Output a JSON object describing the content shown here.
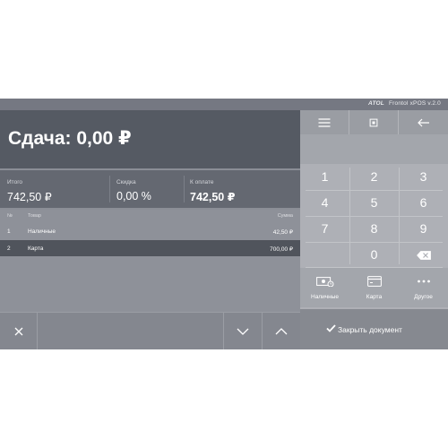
{
  "app": {
    "logo": "ATOL",
    "title": "Frontol xPOS v.2.0"
  },
  "change": {
    "text": "Сдача: 0,00 ₽"
  },
  "totals": {
    "total_label": "Итого",
    "total_value": "742,50 ₽",
    "discount_label": "Скидка",
    "discount_value": "0,00 %",
    "topay_label": "К оплате",
    "topay_value": "742,50 ₽"
  },
  "list": {
    "headers": {
      "num": "№",
      "item": "Товар",
      "sum": "Сумма"
    },
    "rows": [
      {
        "num": "1",
        "item": "Наличные",
        "sum": "42,50 ₽",
        "selected": false
      },
      {
        "num": "2",
        "item": "Карта",
        "sum": "700,00 ₽",
        "selected": true
      }
    ]
  },
  "bottom_bar": {
    "icons": [
      "close-icon",
      "chevron-down-icon",
      "chevron-up-icon"
    ]
  },
  "right_top": {
    "icons": [
      "menu-icon",
      "scanner-icon",
      "back-arrow-icon"
    ]
  },
  "keypad": {
    "keys": [
      "1",
      "2",
      "3",
      "4",
      "5",
      "6",
      "7",
      "8",
      "9",
      "",
      "0",
      ""
    ],
    "backspace_icon": "backspace-icon"
  },
  "payments": {
    "cash_label": "Наличные",
    "card_label": "Карта",
    "other_label": "Другое"
  },
  "close_document": {
    "label": "Закрыть документ",
    "icon": "checkmark-icon"
  },
  "colors": {
    "screen_bg": "#8b8e96",
    "dark_panel": "#555a63",
    "selected_row": "#50545c",
    "keypad_bg": "#aeb0b6"
  }
}
